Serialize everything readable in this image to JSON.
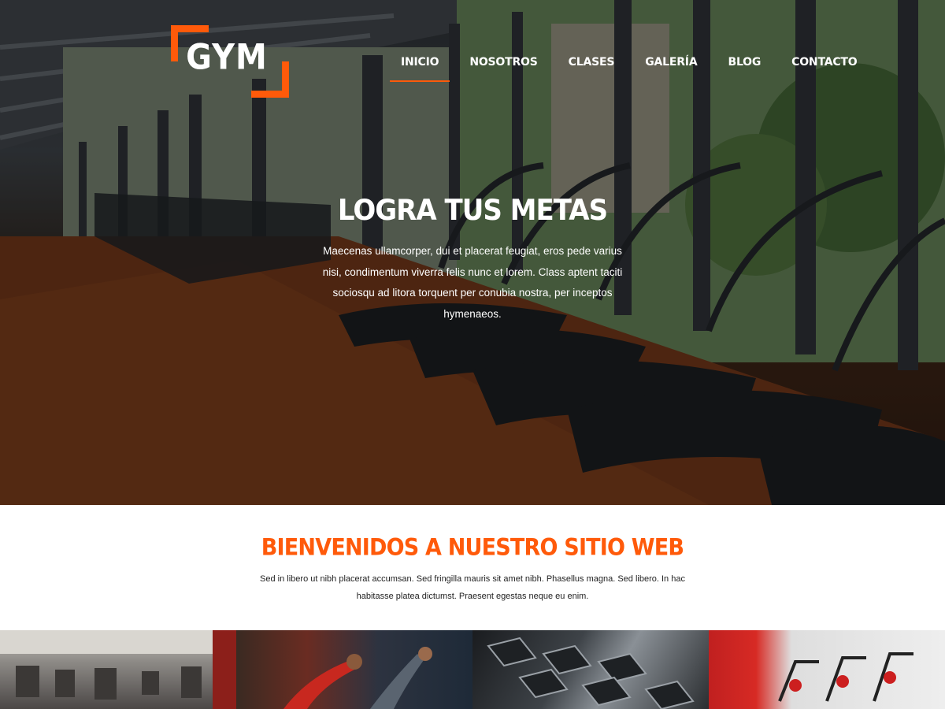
{
  "brand": {
    "logo_text": "GYM",
    "accent_color": "#ff5a0a"
  },
  "nav": {
    "items": [
      {
        "label": "INICIO",
        "active": true
      },
      {
        "label": "NOSOTROS",
        "active": false
      },
      {
        "label": "CLASES",
        "active": false
      },
      {
        "label": "GALERÍA",
        "active": false
      },
      {
        "label": "BLOG",
        "active": false
      },
      {
        "label": "CONTACTO",
        "active": false
      }
    ]
  },
  "hero": {
    "title": "LOGRA TUS METAS",
    "text": "Maecenas ullamcorper, dui et placerat feugiat, eros pede varius nisi, condimentum viverra felis nunc et lorem. Class aptent taciti sociosqu ad litora torquent per conubia nostra, per inceptos hymenaeos.",
    "image": "gym-interior-treadmills-photo"
  },
  "welcome": {
    "title": "BIENVENIDOS A NUESTRO SITIO WEB",
    "text": "Sed in libero ut nibh placerat accumsan. Sed fringilla mauris sit amet nibh. Phasellus magna. Sed libero. In hac habitasse platea dictumst. Praesent egestas neque eu enim."
  },
  "gallery": {
    "images": [
      "gym-floor-photo",
      "stretching-class-photo",
      "dumbbells-photo",
      "spinning-bikes-photo"
    ]
  }
}
